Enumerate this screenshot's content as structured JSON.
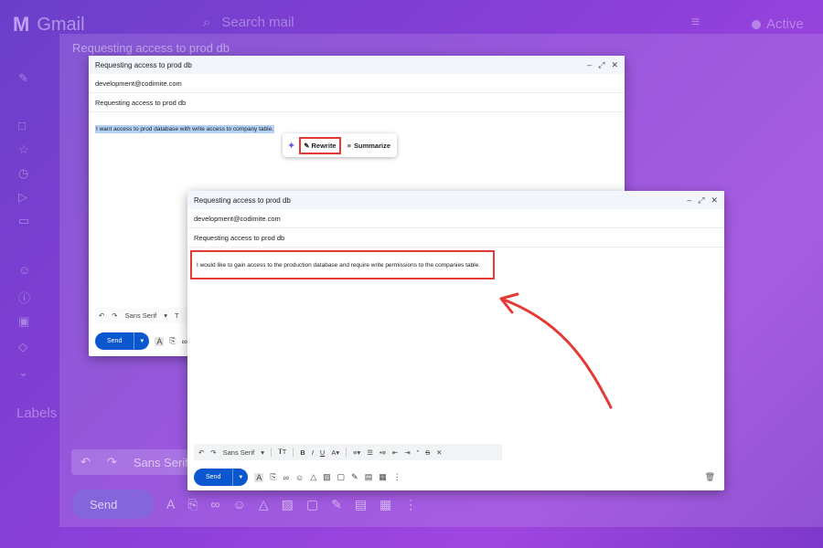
{
  "background": {
    "app_name": "Gmail",
    "search_placeholder": "Search mail",
    "status": "Active",
    "labels_heading": "Labels",
    "compose_title": "Requesting access to prod db",
    "toolbar_font": "Sans Serif",
    "send_label": "Send"
  },
  "compose_a": {
    "title": "Requesting access to prod db",
    "to": "development@codimite.com",
    "subject": "Requesting access to prod db",
    "body_selected": "I want access to prod database with write access to company table.",
    "ai_popup": {
      "rewrite_label": "Rewrite",
      "summarize_label": "Summarize"
    },
    "font_label": "Sans Serif",
    "send_label": "Send"
  },
  "compose_b": {
    "title": "Requesting access to prod db",
    "to": "development@codimite.com",
    "subject": "Requesting access to prod db",
    "body_rewritten": "I would like to gain access to the production database and require write permissions to the companies table.",
    "font_label": "Sans Serif",
    "send_label": "Send"
  },
  "colors": {
    "accent_red": "#e53935",
    "send_blue": "#0b57d0",
    "selection_blue": "#b4d2f6"
  }
}
